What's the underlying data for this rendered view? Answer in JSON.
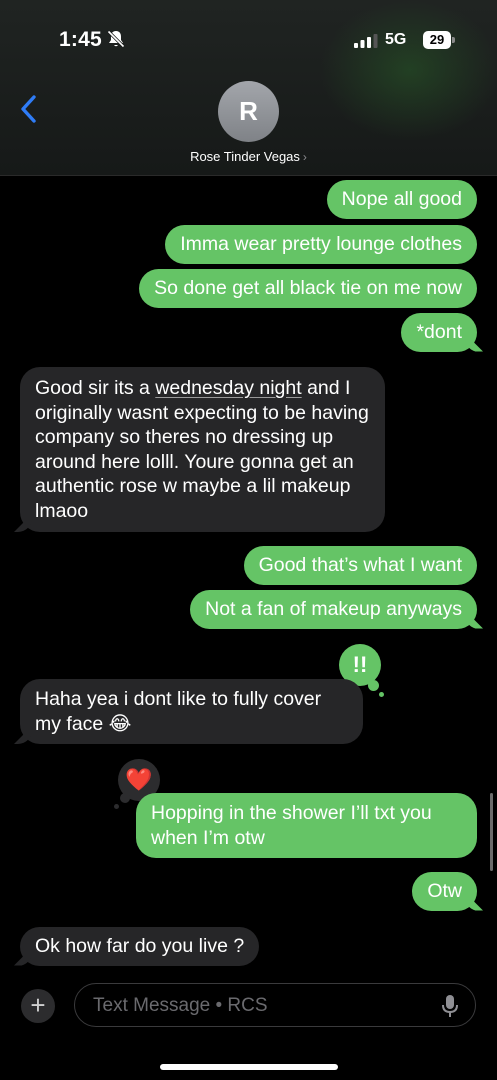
{
  "status_bar": {
    "time": "1:45",
    "network": "5G",
    "battery": "29"
  },
  "header": {
    "avatar_initial": "R",
    "contact_name": "Rose Tinder Vegas",
    "chevron": "›"
  },
  "messages": [
    {
      "dir": "out",
      "text": "Nope all good"
    },
    {
      "dir": "out",
      "text": "Imma wear pretty lounge clothes"
    },
    {
      "dir": "out",
      "text": "So done get all black tie on me now"
    },
    {
      "dir": "out",
      "text": "*dont"
    },
    {
      "dir": "in",
      "parts": [
        "Good sir its a ",
        "wednesday night",
        " and I originally wasnt expecting to be having company so theres no dressing up around here lolll. Youre gonna get an authentic rose w maybe a lil makeup lmaoo"
      ]
    },
    {
      "dir": "out",
      "text": "Good that’s what I want"
    },
    {
      "dir": "out",
      "text": "Not a fan of makeup anyways"
    },
    {
      "dir": "in",
      "text": "Haha yea i dont like to fully cover my face 😂",
      "reaction": "!!"
    },
    {
      "dir": "out",
      "text": "Hopping in the shower I’ll txt you when I’m otw",
      "reaction": "❤️"
    },
    {
      "dir": "out",
      "text": "Otw"
    },
    {
      "dir": "in",
      "text": "Ok how far do you live ?"
    }
  ],
  "composer": {
    "plus": "+",
    "placeholder": "Text Message • RCS"
  },
  "colors": {
    "outgoing": "#65c466",
    "incoming": "#262628",
    "accent": "#2f7cf6"
  },
  "icons": [
    "bell-slash-icon",
    "signal-icon",
    "battery-icon",
    "back-chevron-icon",
    "plus-icon",
    "microphone-icon",
    "heart-icon",
    "exclamation-icon"
  ]
}
